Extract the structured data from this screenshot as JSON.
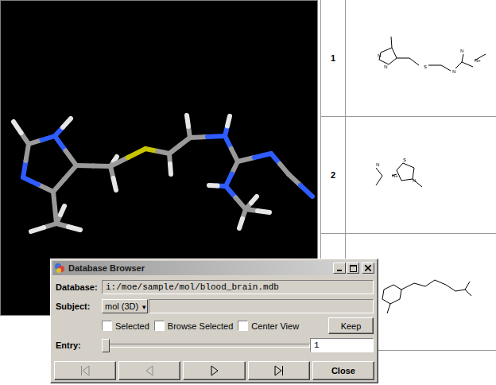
{
  "structure_table": {
    "rows": [
      {
        "number": "1",
        "atoms": [
          "N",
          "N",
          "S",
          "N",
          "N",
          "N+"
        ]
      },
      {
        "number": "2",
        "atoms": [
          "S",
          "N",
          "N",
          "N+"
        ]
      },
      {
        "atoms": []
      }
    ]
  },
  "dialog": {
    "title": "Database Browser",
    "database": {
      "label": "Database:",
      "value": "i:/moe/sample/mol/blood_brain.mdb"
    },
    "subject": {
      "label": "Subject:",
      "value": "mol (3D)",
      "arrow": "▼",
      "field": ""
    },
    "checkboxes": [
      {
        "label": "Selected",
        "checked": false
      },
      {
        "label": "Browse Selected",
        "checked": false
      },
      {
        "label": "Center View",
        "checked": false
      }
    ],
    "keep_button": "Keep",
    "entry": {
      "label": "Entry:",
      "level": 0,
      "value": "1"
    },
    "nav_buttons": [
      {
        "kind": "first",
        "disabled": true
      },
      {
        "kind": "previous",
        "disabled": true
      },
      {
        "kind": "next",
        "disabled": false
      },
      {
        "kind": "last",
        "disabled": false
      }
    ],
    "close_button": "Close"
  }
}
